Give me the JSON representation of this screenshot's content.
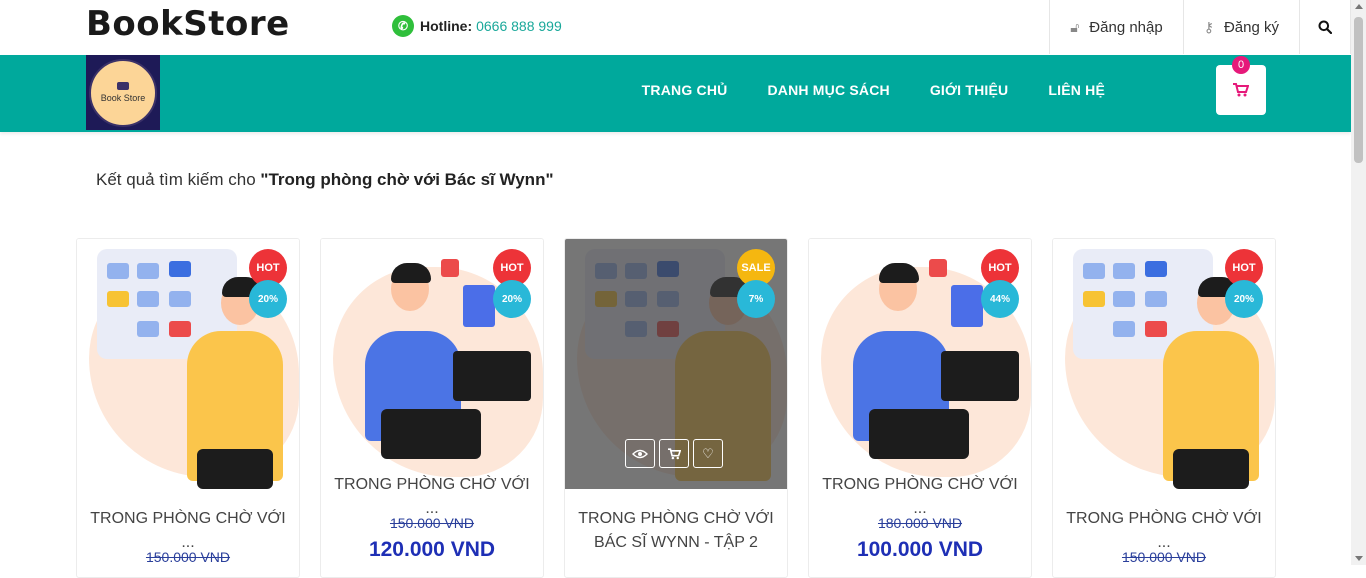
{
  "header": {
    "brand": "BookStore",
    "hotline_label": "Hotline:",
    "hotline_number": "0666 888 999",
    "login": "Đăng nhập",
    "register": "Đăng ký"
  },
  "navbar": {
    "logo_text": "Book Store",
    "items": [
      "TRANG CHỦ",
      "DANH MỤC SÁCH",
      "GIỚI THIỆU",
      "LIÊN HỆ"
    ],
    "cart_count": "0",
    "accent": "#00a99c"
  },
  "search": {
    "prefix": "Kết quả tìm kiếm cho ",
    "query": "\"Trong phòng chờ với Bác sĩ Wynn\""
  },
  "products": [
    {
      "badge": "HOT",
      "discount": "20%",
      "title": "TRONG PHÒNG CHỜ VỚI ...",
      "old_price": "150.000 VND",
      "new_price": ""
    },
    {
      "badge": "HOT",
      "discount": "20%",
      "title": "TRONG PHÒNG CHỜ VỚI ...",
      "old_price": "150.000 VND",
      "new_price": "120.000 VND"
    },
    {
      "badge": "SALE",
      "discount": "7%",
      "title": "TRONG PHÒNG CHỜ VỚI BÁC SĨ WYNN - TẬP 2",
      "old_price": "",
      "new_price": ""
    },
    {
      "badge": "HOT",
      "discount": "44%",
      "title": "TRONG PHÒNG CHỜ VỚI ...",
      "old_price": "180.000 VND",
      "new_price": "100.000 VND"
    },
    {
      "badge": "HOT",
      "discount": "20%",
      "title": "TRONG PHÒNG CHỜ VỚI ...",
      "old_price": "150.000 VND",
      "new_price": ""
    }
  ]
}
